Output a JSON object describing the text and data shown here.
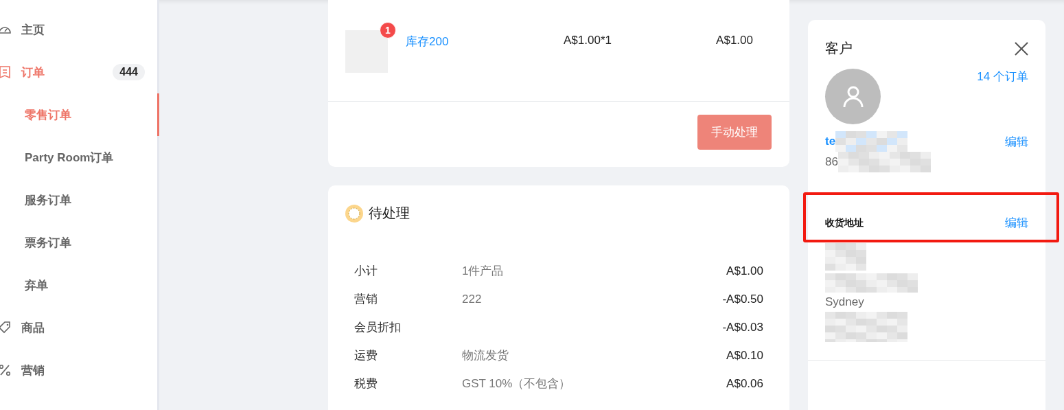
{
  "sidebar": {
    "items": [
      {
        "label": "主页",
        "selected": false
      },
      {
        "label": "订单",
        "selected": true,
        "badge": "444",
        "children": [
          {
            "label": "零售订单",
            "selected": true
          },
          {
            "label": "Party Room订单",
            "selected": false
          },
          {
            "label": "服务订单",
            "selected": false
          },
          {
            "label": "票务订单",
            "selected": false
          },
          {
            "label": "弃单",
            "selected": false
          }
        ]
      },
      {
        "label": "商品",
        "selected": false
      },
      {
        "label": "营销",
        "selected": false
      }
    ]
  },
  "product": {
    "name": "库存200",
    "quantity_badge": "1",
    "unit_price": "A$1.00*1",
    "total": "A$1.00",
    "action": "手动处理"
  },
  "summary": {
    "title": "待处理",
    "rows": [
      {
        "label": "小计",
        "detail": "1件产品",
        "amount": "A$1.00"
      },
      {
        "label": "营销",
        "detail": "222",
        "amount": "-A$0.50"
      },
      {
        "label": "会员折扣",
        "amount": "-A$0.03"
      },
      {
        "label": "运费",
        "detail": "物流发货",
        "amount": "A$0.10"
      },
      {
        "label": "税费",
        "detail": "GST 10%（不包含）",
        "amount": "A$0.06"
      }
    ]
  },
  "customer": {
    "title": "客户",
    "order_count": "14 个订单",
    "name": "te",
    "phone": "86",
    "edit": "编辑",
    "address": {
      "title": "收货地址",
      "edit": "编辑",
      "city": "Sydney"
    }
  }
}
